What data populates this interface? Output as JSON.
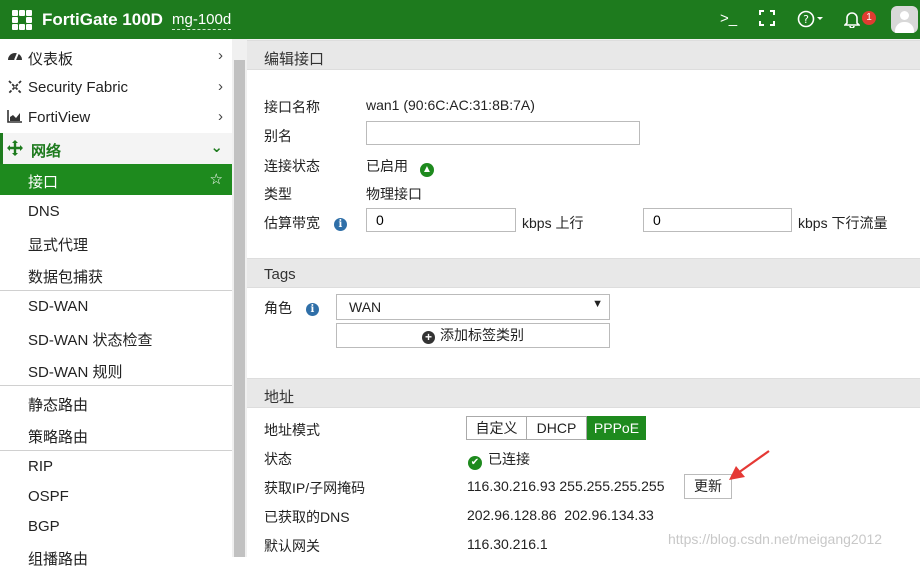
{
  "header": {
    "product": "FortiGate 100D",
    "hostname": "mg-100d",
    "notification_count": "1",
    "icons": [
      "terminal-icon",
      "fullscreen-icon",
      "help-icon",
      "bell-icon",
      "user-avatar"
    ]
  },
  "sidebar": {
    "items": [
      {
        "label": "仪表板",
        "icon": "dashboard-icon"
      },
      {
        "label": "Security Fabric",
        "icon": "fabric-icon"
      },
      {
        "label": "FortiView",
        "icon": "chart-icon"
      },
      {
        "label": "网络",
        "icon": "network-icon"
      },
      {
        "label": "接口"
      },
      {
        "label": "DNS"
      },
      {
        "label": "显式代理"
      },
      {
        "label": "数据包捕获"
      },
      {
        "label": "SD-WAN"
      },
      {
        "label": "SD-WAN 状态检查"
      },
      {
        "label": "SD-WAN 规则"
      },
      {
        "label": "静态路由"
      },
      {
        "label": "策略路由"
      },
      {
        "label": "RIP"
      },
      {
        "label": "OSPF"
      },
      {
        "label": "BGP"
      },
      {
        "label": "组播路由"
      }
    ]
  },
  "edit": {
    "section_title": "编辑接口",
    "name_label": "接口名称",
    "name_value": "wan1 (90:6C:AC:31:8B:7A)",
    "alias_label": "别名",
    "alias_value": "",
    "status_label": "连接状态",
    "status_value": "已启用",
    "type_label": "类型",
    "type_value": "物理接口",
    "bandwidth_label": "估算带宽",
    "upstream_value": "0",
    "upstream_unit": "kbps 上行",
    "downstream_value": "0",
    "downstream_unit": "kbps 下行流量"
  },
  "tags": {
    "section_title": "Tags",
    "role_label": "角色",
    "role_value": "WAN",
    "add_category": "添加标签类别"
  },
  "address": {
    "section_title": "地址",
    "mode_label": "地址模式",
    "modes": [
      "自定义",
      "DHCP",
      "PPPoE"
    ],
    "active_mode": "PPPoE",
    "state_label": "状态",
    "state_value": "已连接",
    "ip_label": "获取IP/子网掩码",
    "ip_value": "116.30.216.93 255.255.255.255",
    "refresh_button": "更新",
    "dns_label": "已获取的DNS",
    "dns_value": "202.96.128.86  202.96.134.33",
    "gateway_label": "默认网关",
    "gateway_value": "116.30.216.1"
  },
  "watermark": "https://blog.csdn.net/meigang2012",
  "colors": {
    "brand": "#1e7b1e",
    "selected": "#1e8a1e",
    "arrow": "#e53935"
  }
}
